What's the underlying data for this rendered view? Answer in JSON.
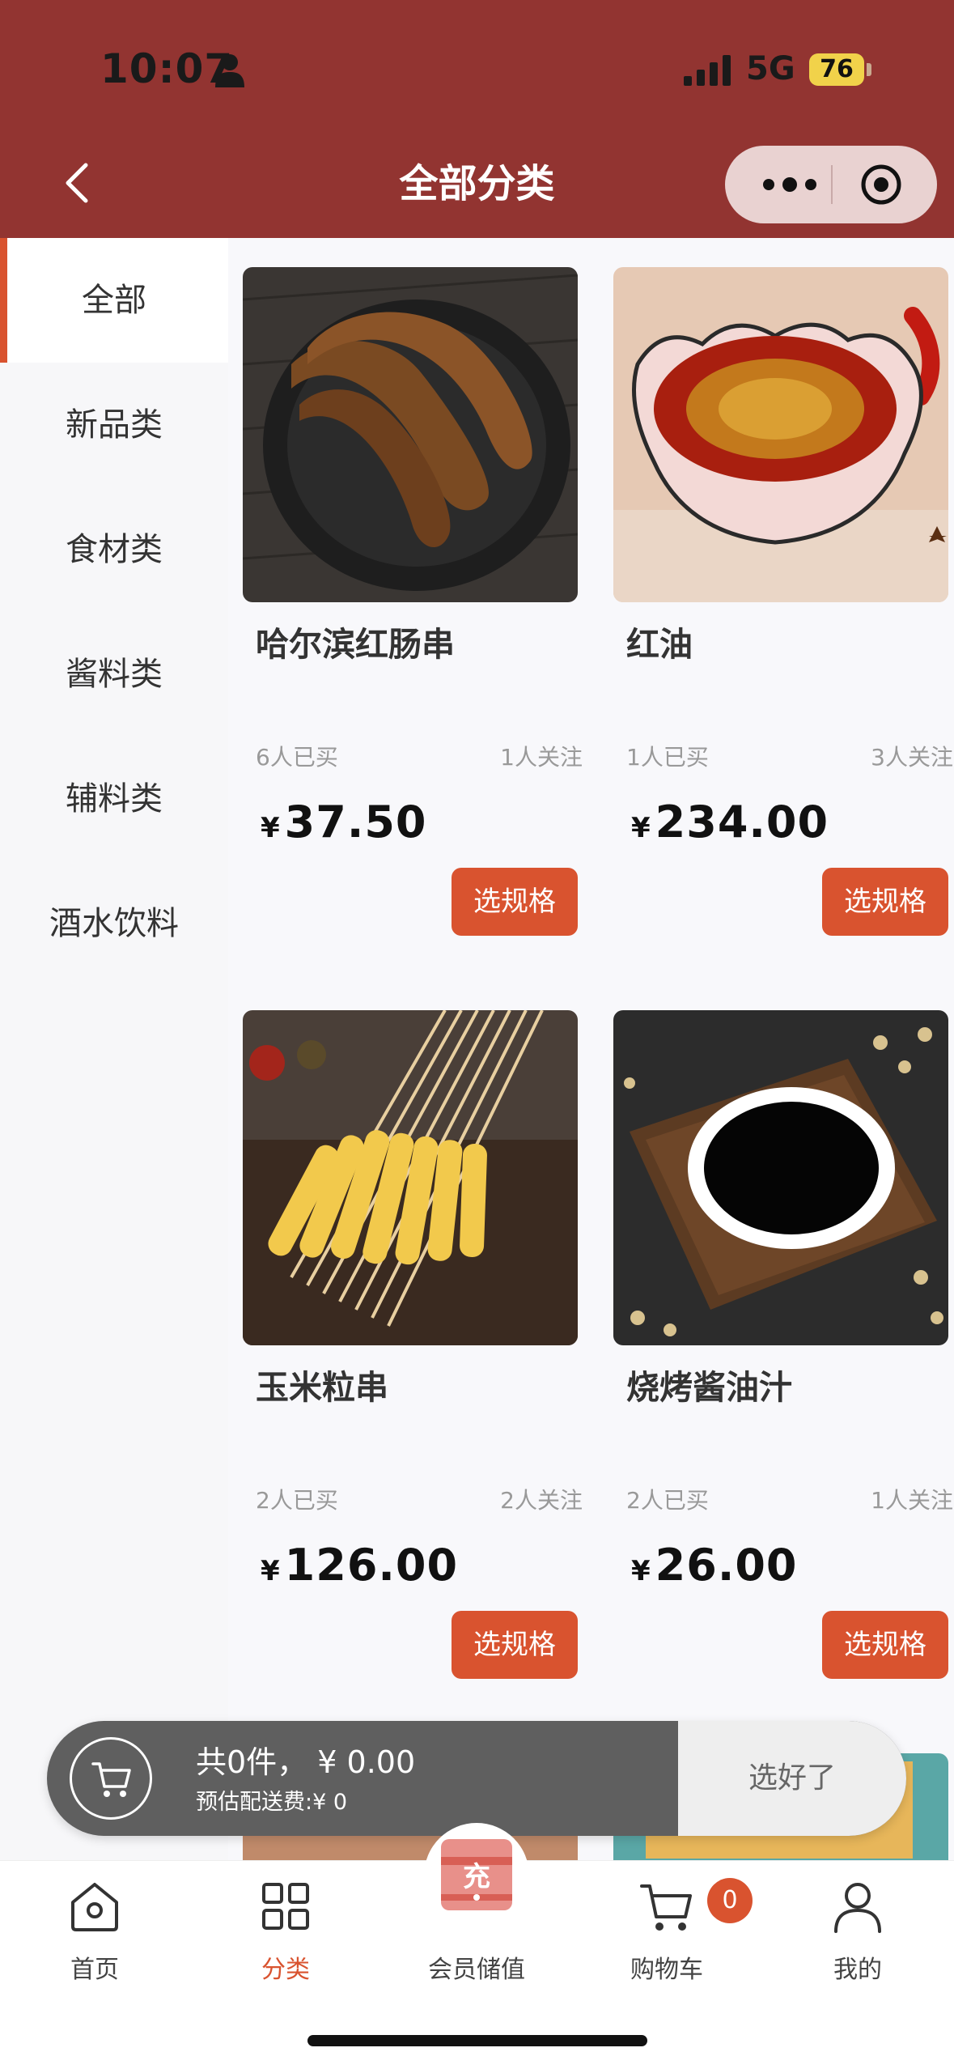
{
  "status_bar": {
    "time": "10:07",
    "network": "5G",
    "battery": "76"
  },
  "header": {
    "title": "全部分类"
  },
  "sidebar": {
    "items": [
      {
        "label": "全部",
        "active": true
      },
      {
        "label": "新品类",
        "active": false
      },
      {
        "label": "食材类",
        "active": false
      },
      {
        "label": "酱料类",
        "active": false
      },
      {
        "label": "辅料类",
        "active": false
      },
      {
        "label": "酒水饮料",
        "active": false
      }
    ]
  },
  "products": [
    {
      "name": "哈尔滨红肠串",
      "bought": "6人已买",
      "follow": "1人关注",
      "price_symbol": "¥",
      "price": "37.50",
      "button": "选规格"
    },
    {
      "name": "红油",
      "bought": "1人已买",
      "follow": "3人关注",
      "price_symbol": "¥",
      "price": "234.00",
      "button": "选规格"
    },
    {
      "name": "玉米粒串",
      "bought": "2人已买",
      "follow": "2人关注",
      "price_symbol": "¥",
      "price": "126.00",
      "button": "选规格"
    },
    {
      "name": "烧烤酱油汁",
      "bought": "2人已买",
      "follow": "1人关注",
      "price_symbol": "¥",
      "price": "26.00",
      "button": "选规格"
    }
  ],
  "cart_bar": {
    "total": "共0件，  ¥ 0.00",
    "delivery_fee": "预估配送费:¥ 0",
    "checkout": "选好了"
  },
  "tabbar": {
    "items": [
      {
        "label": "首页",
        "icon": "home-icon",
        "active": false
      },
      {
        "label": "分类",
        "icon": "grid-icon",
        "active": true
      },
      {
        "label": "会员储值",
        "icon": "recharge-icon",
        "active": false
      },
      {
        "label": "购物车",
        "icon": "cart-icon",
        "active": false
      },
      {
        "label": "我的",
        "icon": "user-icon",
        "active": false
      }
    ],
    "recharge_glyph": "充",
    "cart_badge": "0"
  },
  "colors": {
    "header_bg": "#923431",
    "accent": "#d9532f",
    "cart_bar_bg": "#5f5f5f"
  }
}
